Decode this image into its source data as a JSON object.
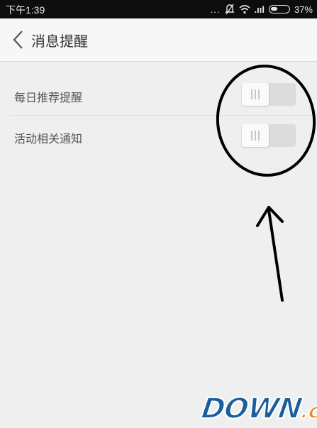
{
  "status_bar": {
    "time": "下午1:39",
    "dots": "...",
    "signal": ".ııl",
    "battery_percent": "37%",
    "battery_level": 0.37
  },
  "header": {
    "title": "消息提醒"
  },
  "settings": [
    {
      "label": "每日推荐提醒",
      "enabled": false
    },
    {
      "label": "活动相关通知",
      "enabled": false
    }
  ],
  "watermark": {
    "main": "DOWN",
    "suffix": ".cc"
  },
  "colors": {
    "status_bar": "#0d0d0d",
    "background": "#efefef",
    "header": "#f7f7f7",
    "toggle_track": "#dcdcdc",
    "annotation": "#000000",
    "watermark_blue": "#1a5e9e",
    "watermark_orange": "#e8891a"
  }
}
